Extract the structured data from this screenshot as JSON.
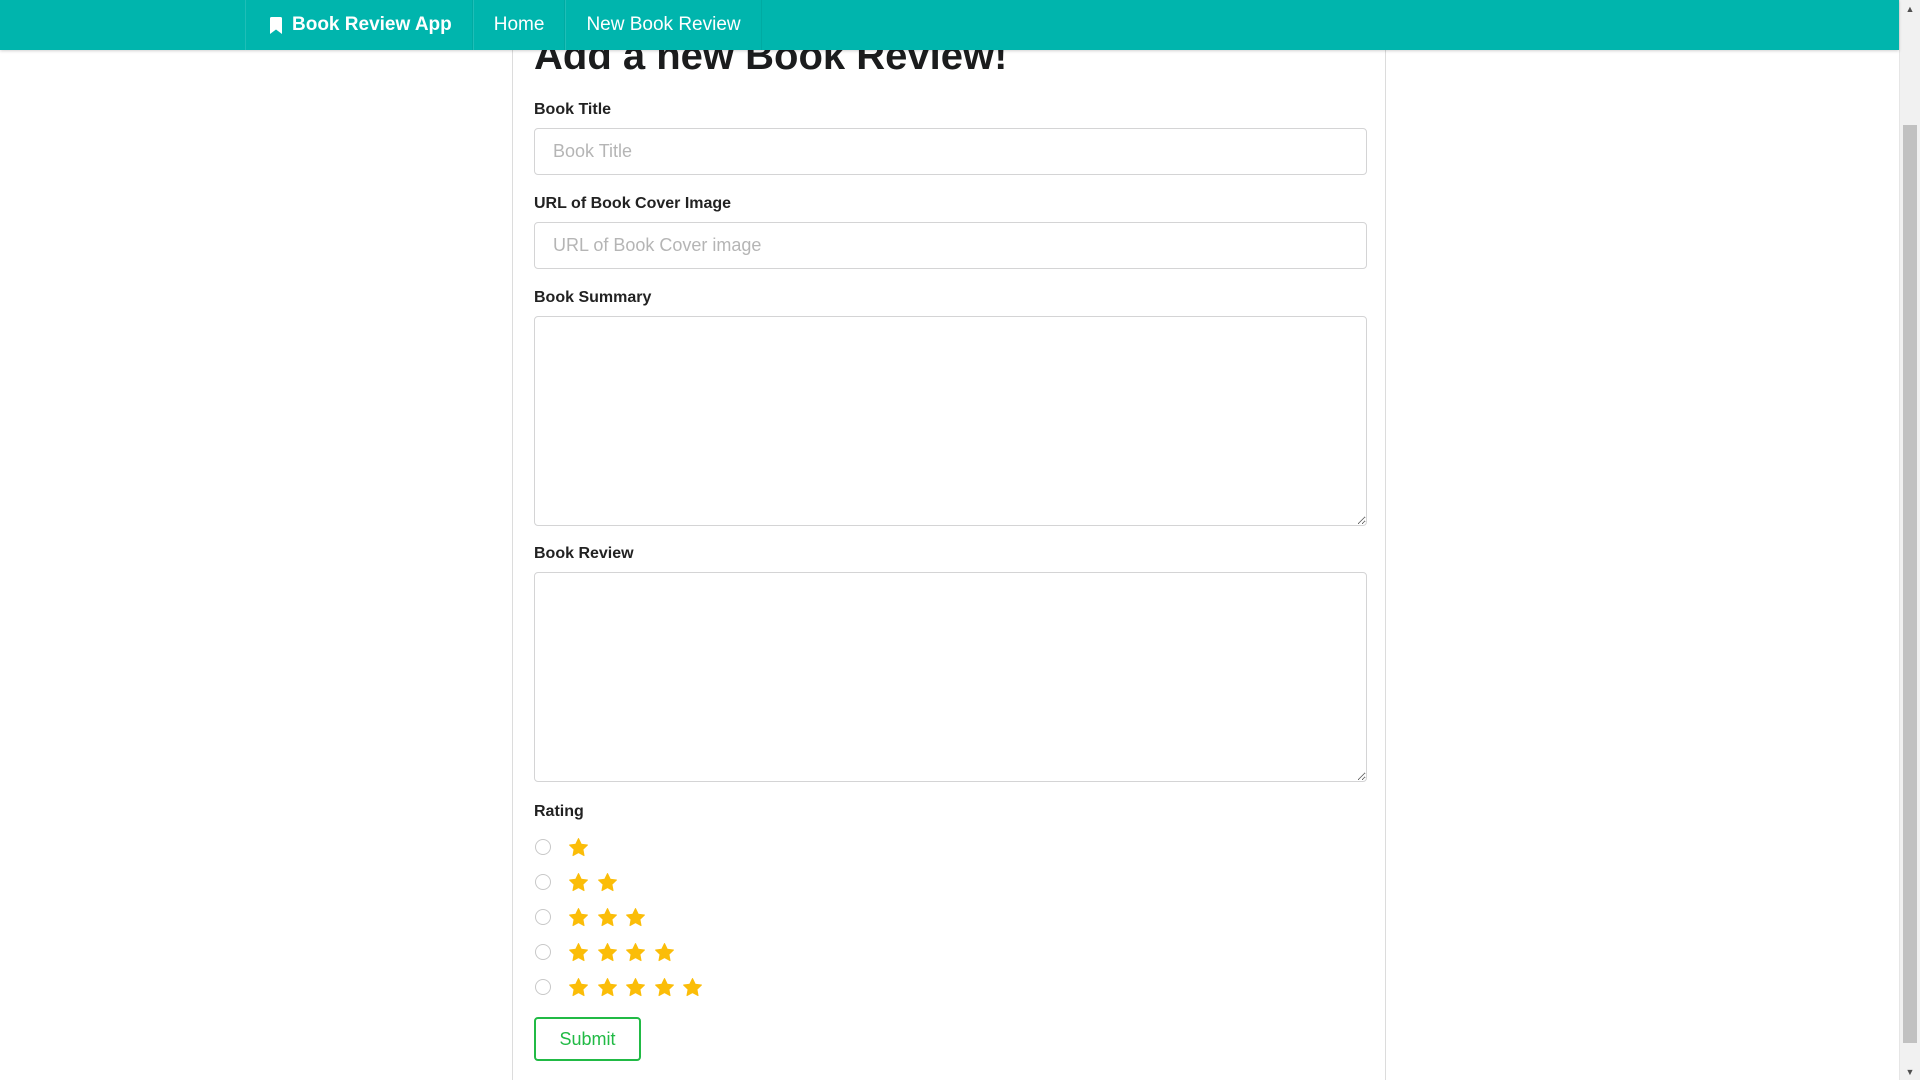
{
  "navbar": {
    "brand_label": "Book Review App",
    "brand_icon": "bookmark-icon",
    "items": [
      {
        "label": "Home"
      },
      {
        "label": "New Book Review"
      }
    ],
    "background_color": "#00b5ad"
  },
  "page": {
    "title": "Add a new Book Review!"
  },
  "form": {
    "book_title": {
      "label": "Book Title",
      "placeholder": "Book Title",
      "value": ""
    },
    "cover_url": {
      "label": "URL of Book Cover Image",
      "placeholder": "URL of Book Cover image",
      "value": ""
    },
    "summary": {
      "label": "Book Summary",
      "value": ""
    },
    "review": {
      "label": "Book Review",
      "value": ""
    },
    "rating": {
      "label": "Rating",
      "options": [
        {
          "stars": 1
        },
        {
          "stars": 2
        },
        {
          "stars": 3
        },
        {
          "stars": 4
        },
        {
          "stars": 5
        }
      ],
      "star_icon": "star-icon",
      "star_color": "#fbbd08"
    },
    "submit_label": "Submit",
    "submit_color": "#21ba45"
  }
}
